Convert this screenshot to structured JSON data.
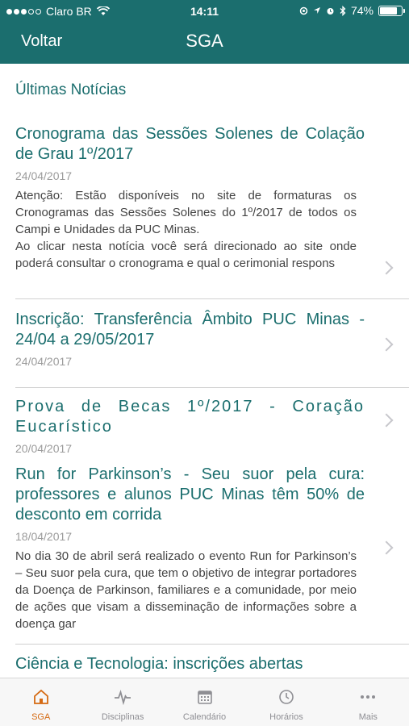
{
  "status_bar": {
    "carrier": "Claro BR",
    "time": "14:11",
    "battery": "74%",
    "battery_level": 0.74,
    "icons": [
      "signal-dots",
      "wifi-icon",
      "location-icon",
      "alarm-icon",
      "bluetooth-icon",
      "battery-icon"
    ]
  },
  "nav": {
    "back_label": "Voltar",
    "title": "SGA",
    "background_color": "#1b6e6e"
  },
  "main": {
    "section_title": "Últimas Notícias",
    "news": [
      {
        "title": "Cronograma das Sessões Solenes de Colação de Grau 1º/2017",
        "date": "24/04/2017",
        "body": "Atenção: Estão disponíveis no site de formaturas os Cronogramas das Sessões Solenes do 1º/2017 de todos os Campi e Unidades da PUC Minas.\nAo clicar nesta notícia você será direcionado ao site onde poderá consultar o cronograma e qual o cerimonial respons"
      },
      {
        "title": "Inscrição: Transferência Âmbito PUC Minas - 24/04 a 29/05/2017",
        "date": "24/04/2017",
        "body": ""
      },
      {
        "title": "Prova de Becas 1º/2017 - Coração Eucarístico",
        "date": "20/04/2017",
        "body": ""
      },
      {
        "title": "Run for Parkinson’s - Seu suor pela cura: professores e alunos PUC Minas têm 50% de desconto em corrida",
        "date": "18/04/2017",
        "body": "No dia 30 de abril será realizado o evento Run for Parkinson’s – Seu suor pela cura, que tem o objetivo de integrar portadores da Doença de Parkinson, familiares e a comunidade, por meio de ações que visam a disseminação de informações sobre a doença gar"
      },
      {
        "title": "Ciência e Tecnologia: inscrições abertas",
        "date": "",
        "body": ""
      }
    ]
  },
  "tabbar": {
    "active_color": "#d56a12",
    "tabs": [
      {
        "label": "SGA",
        "icon": "home-icon",
        "active": true
      },
      {
        "label": "Disciplinas",
        "icon": "pulse-icon",
        "active": false
      },
      {
        "label": "Calendário",
        "icon": "calendar-icon",
        "active": false
      },
      {
        "label": "Horários",
        "icon": "clock-icon",
        "active": false
      },
      {
        "label": "Mais",
        "icon": "more-icon",
        "active": false
      }
    ]
  }
}
